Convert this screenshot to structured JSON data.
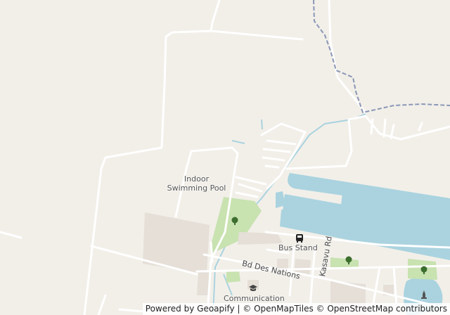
{
  "map": {
    "colors": {
      "background": "#f2efe9",
      "water": "#aad3df",
      "park": "#c8e2b0",
      "building": "#e5dfd8",
      "road": "#ffffff",
      "boundary": "#8a97b5"
    },
    "labels": {
      "indoor_pool_line1": "Indoor",
      "indoor_pool_line2": "Swimming Pool",
      "bus_stand": "Bus Stand",
      "road_nations": "Bd Des Nations",
      "road_kasavu": "Kasavu Rd",
      "communication": "Communication"
    },
    "icons": [
      "tree-icon",
      "bus-icon",
      "school-icon",
      "tree-icon",
      "tree-icon",
      "memorial-icon"
    ]
  },
  "attribution": {
    "powered": "Powered by Geoapify",
    "sep1": " | ",
    "omt": "© OpenMapTiles",
    "sep2": " ",
    "osm": "© OpenStreetMap contributors"
  }
}
